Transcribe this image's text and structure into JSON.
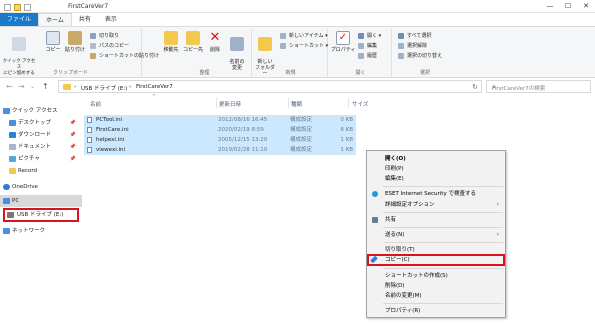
{
  "window": {
    "title": "FirstCareVer7"
  },
  "window_buttons": [
    "—",
    "☐",
    "✕"
  ],
  "ribbon_tabs": [
    "ファイル",
    "ホーム",
    "共有",
    "表示"
  ],
  "ribbon": {
    "clipboard": {
      "quick_access": "クイック アクセス\nにピン留めする",
      "copy": "コピー",
      "paste": "貼り付け",
      "cut": "切り取り",
      "copy_path": "パスのコピー",
      "paste_shortcut": "ショートカットの貼り付け",
      "label": "クリップボード"
    },
    "organize": {
      "move_to": "移動先",
      "copy_to": "コピー先",
      "delete": "削除",
      "rename": "名前の\n変更",
      "label": "整理"
    },
    "new": {
      "new_folder": "新しい\nフォルダー",
      "new_item": "新しいアイテム ▾",
      "shortcut": "ショートカット ▾",
      "label": "新規"
    },
    "open": {
      "properties": "プロパティ",
      "open": "開く ▾",
      "edit": "編集",
      "history": "履歴",
      "label": "開く"
    },
    "select": {
      "select_all": "すべて選択",
      "select_none": "選択解除",
      "invert": "選択の切り替え",
      "label": "選択"
    }
  },
  "address": {
    "crumbs": [
      "›",
      "USB ドライブ (E:)",
      "›",
      "FirstCareVer7"
    ],
    "search_placeholder": "FirstCareVer7の検索"
  },
  "nav": {
    "items": [
      {
        "label": "クイック アクセス",
        "icon": "star-icon"
      },
      {
        "label": "デスクトップ",
        "icon": "desktop-icon",
        "pinned": "📌"
      },
      {
        "label": "ダウンロード",
        "icon": "download-icon",
        "pinned": "📌"
      },
      {
        "label": "ドキュメント",
        "icon": "document-icon",
        "pinned": "📌"
      },
      {
        "label": "ピクチャ",
        "icon": "picture-icon",
        "pinned": "📌"
      },
      {
        "label": "Record",
        "icon": "folder-icon"
      },
      {
        "label": "OneDrive",
        "icon": "cloud-icon"
      },
      {
        "label": "PC",
        "icon": "pc-icon"
      },
      {
        "label": "USB ドライブ (E:)",
        "icon": "usb-drive-icon"
      },
      {
        "label": "ネットワーク",
        "icon": "network-icon"
      }
    ]
  },
  "columns": {
    "name": "名前",
    "date": "更新日時",
    "type": "種類",
    "size": "サイズ"
  },
  "files": [
    {
      "name": "PCTool.ini",
      "date": "2012/08/16 16:45",
      "type": "構成設定",
      "size": "0 KB"
    },
    {
      "name": "FirstCare.ini",
      "date": "2020/02/19 8:59",
      "type": "構成設定",
      "size": "8 KB"
    },
    {
      "name": "helpexi.ini",
      "date": "2005/12/15 13:20",
      "type": "構成設定",
      "size": "1 KB"
    },
    {
      "name": "viewexi.ini",
      "date": "2019/02/28 11:10",
      "type": "構成設定",
      "size": "1 KB"
    }
  ],
  "context_menu": {
    "items": [
      "開く(O)",
      "印刷(P)",
      "編集(E)",
      "ESET Internet Security で検査する",
      "詳細設定オプション",
      "共有",
      "送る(N)",
      "切り取り(T)",
      "コピー(C)",
      "ショートカットの作成(S)",
      "削除(D)",
      "名前の変更(M)",
      "プロパティ(R)"
    ]
  },
  "colors": {
    "file_tab": "#1979ca",
    "selection": "#cce8ff",
    "highlight_box": "#d9131f"
  }
}
